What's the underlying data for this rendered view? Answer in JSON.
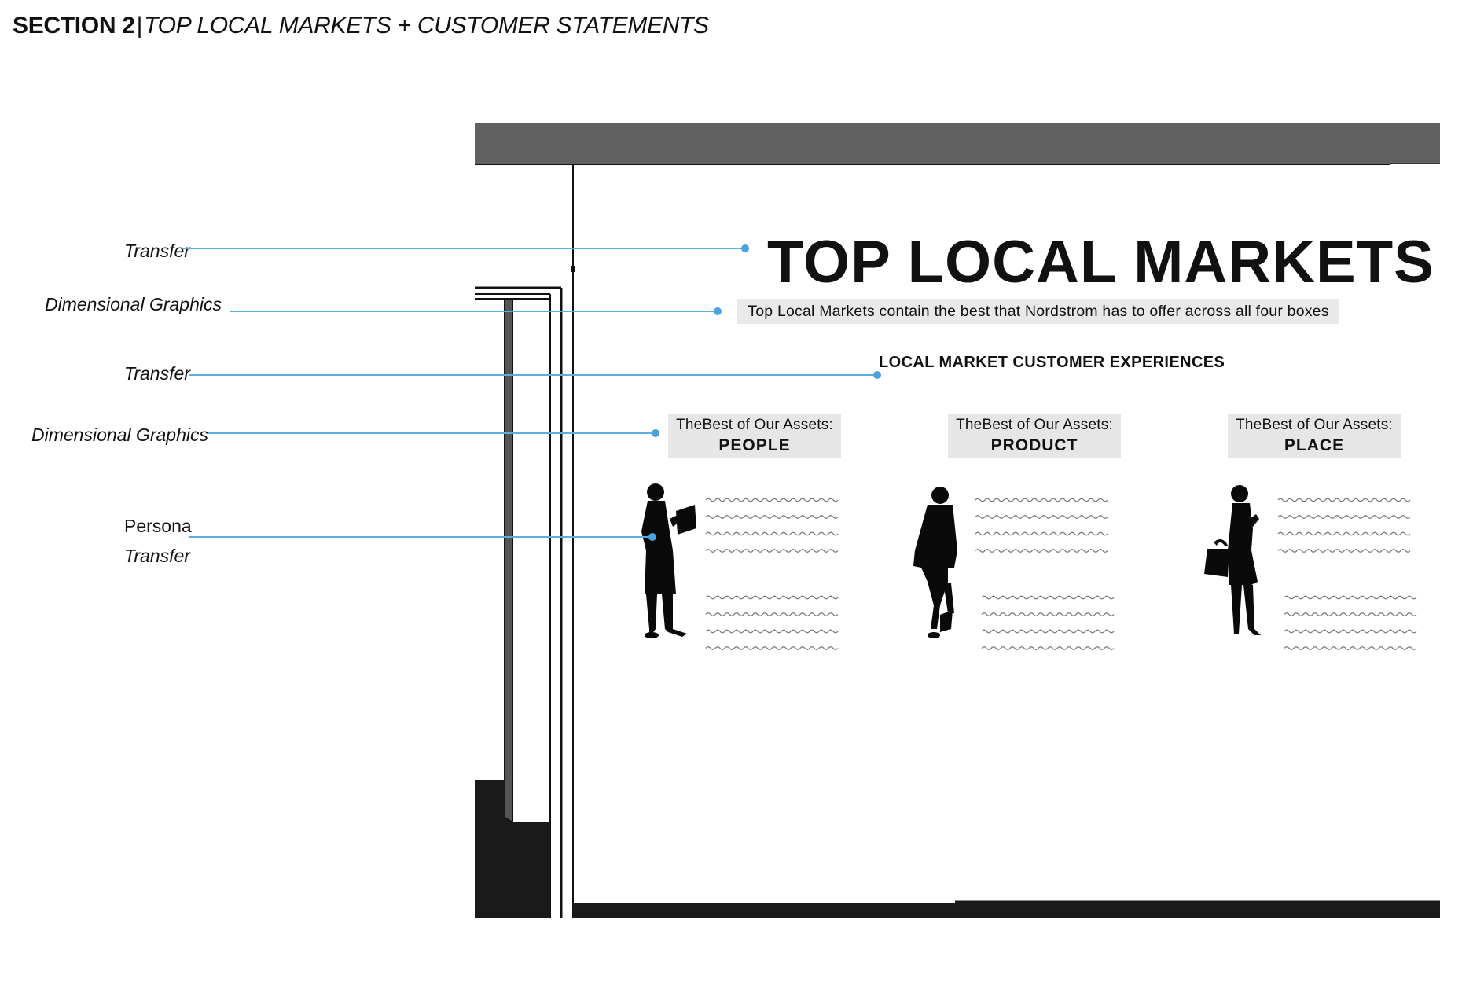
{
  "header": {
    "section": "SECTION 2",
    "separator": "|",
    "subtitle": "TOP LOCAL MARKETS + CUSTOMER STATEMENTS"
  },
  "callouts": [
    {
      "label": "Transfer"
    },
    {
      "label": "Dimensional Graphics"
    },
    {
      "label": "Transfer"
    },
    {
      "label": "Dimensional Graphics"
    },
    {
      "label": "Persona"
    },
    {
      "label": "Transfer"
    }
  ],
  "wall": {
    "title": "TOP LOCAL MARKETS",
    "tagline": "Top Local Markets contain the best that Nordstrom has to offer across all four boxes",
    "section_title": "LOCAL MARKET CUSTOMER EXPERIENCES",
    "assets": [
      {
        "prefix": "TheBest of Our Assets:",
        "name": "PEOPLE",
        "figure": "businesswoman-with-tablet-silhouette"
      },
      {
        "prefix": "TheBest of Our Assets:",
        "name": "PRODUCT",
        "figure": "man-in-suit-silhouette"
      },
      {
        "prefix": "TheBest of Our Assets:",
        "name": "PLACE",
        "figure": "woman-with-handbag-silhouette"
      }
    ]
  },
  "colors": {
    "callout_line": "#5aaee0",
    "soffit": "#606060",
    "floor": "#1a1a1a",
    "label_box": "#e6e6e6"
  }
}
